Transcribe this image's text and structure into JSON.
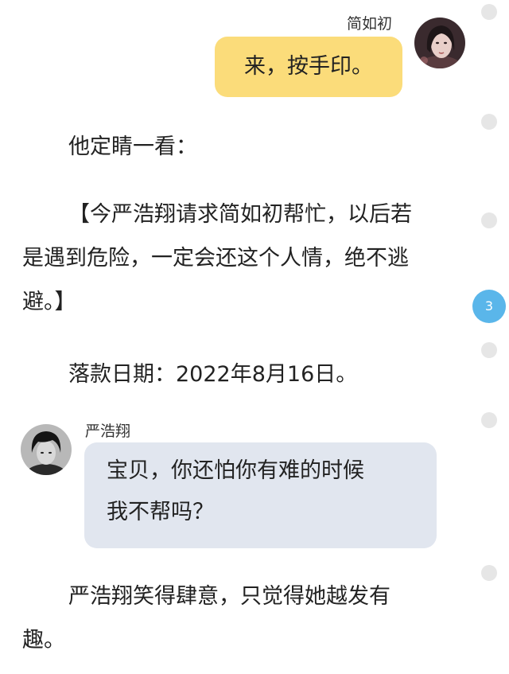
{
  "messages": {
    "first": {
      "sender": "简如初",
      "text": "来，按手印。"
    },
    "second": {
      "sender": "严浩翔",
      "line1": "宝贝，你还怕你有难的时候",
      "line2": "我不帮吗？"
    }
  },
  "story": {
    "p1": "他定睛一看：",
    "p2_line1": "【今严浩翔请求简如初帮忙，以后若",
    "p2_line2": "是遇到危险，一定会还这个人情，绝不逃",
    "p2_line3": "避。】",
    "p3": "落款日期：2022年8月16日。",
    "p4_line1": "严浩翔笑得肆意，只觉得她越发有",
    "p4_line2": "趣。"
  },
  "side": {
    "comment_count": "3"
  },
  "colors": {
    "right_bubble": "#fbdc7a",
    "left_bubble": "#e1e6ef",
    "counter_badge": "#5ab6ea",
    "side_dot": "#e6e6e6"
  }
}
